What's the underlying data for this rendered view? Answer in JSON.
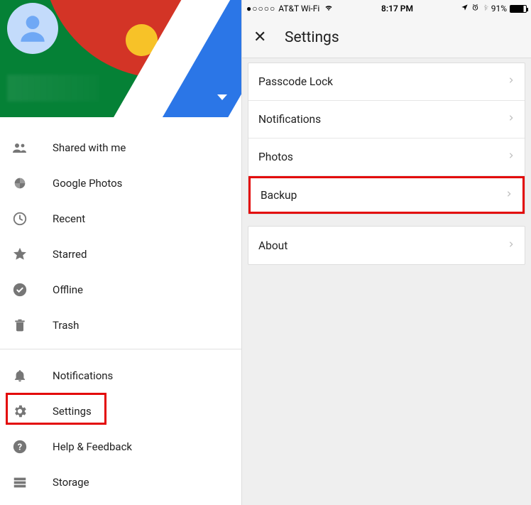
{
  "left_panel": {
    "menu_top": [
      {
        "icon": "people",
        "label": "Shared with me"
      },
      {
        "icon": "pinwheel",
        "label": "Google Photos"
      },
      {
        "icon": "clock",
        "label": "Recent"
      },
      {
        "icon": "star",
        "label": "Starred"
      },
      {
        "icon": "offline",
        "label": "Offline"
      },
      {
        "icon": "trash",
        "label": "Trash"
      }
    ],
    "menu_bottom": [
      {
        "icon": "bell",
        "label": "Notifications"
      },
      {
        "icon": "gear",
        "label": "Settings",
        "highlighted": true
      },
      {
        "icon": "help",
        "label": "Help & Feedback"
      },
      {
        "icon": "storage",
        "label": "Storage"
      }
    ]
  },
  "right_panel": {
    "statusbar": {
      "signal": "●○○○○",
      "carrier": "AT&T Wi-Fi",
      "time": "8:17 PM",
      "battery_pct": "91%"
    },
    "header": {
      "title": "Settings"
    },
    "group1": [
      {
        "label": "Passcode Lock"
      },
      {
        "label": "Notifications"
      },
      {
        "label": "Photos"
      },
      {
        "label": "Backup",
        "highlighted": true
      }
    ],
    "group2": [
      {
        "label": "About"
      }
    ]
  }
}
